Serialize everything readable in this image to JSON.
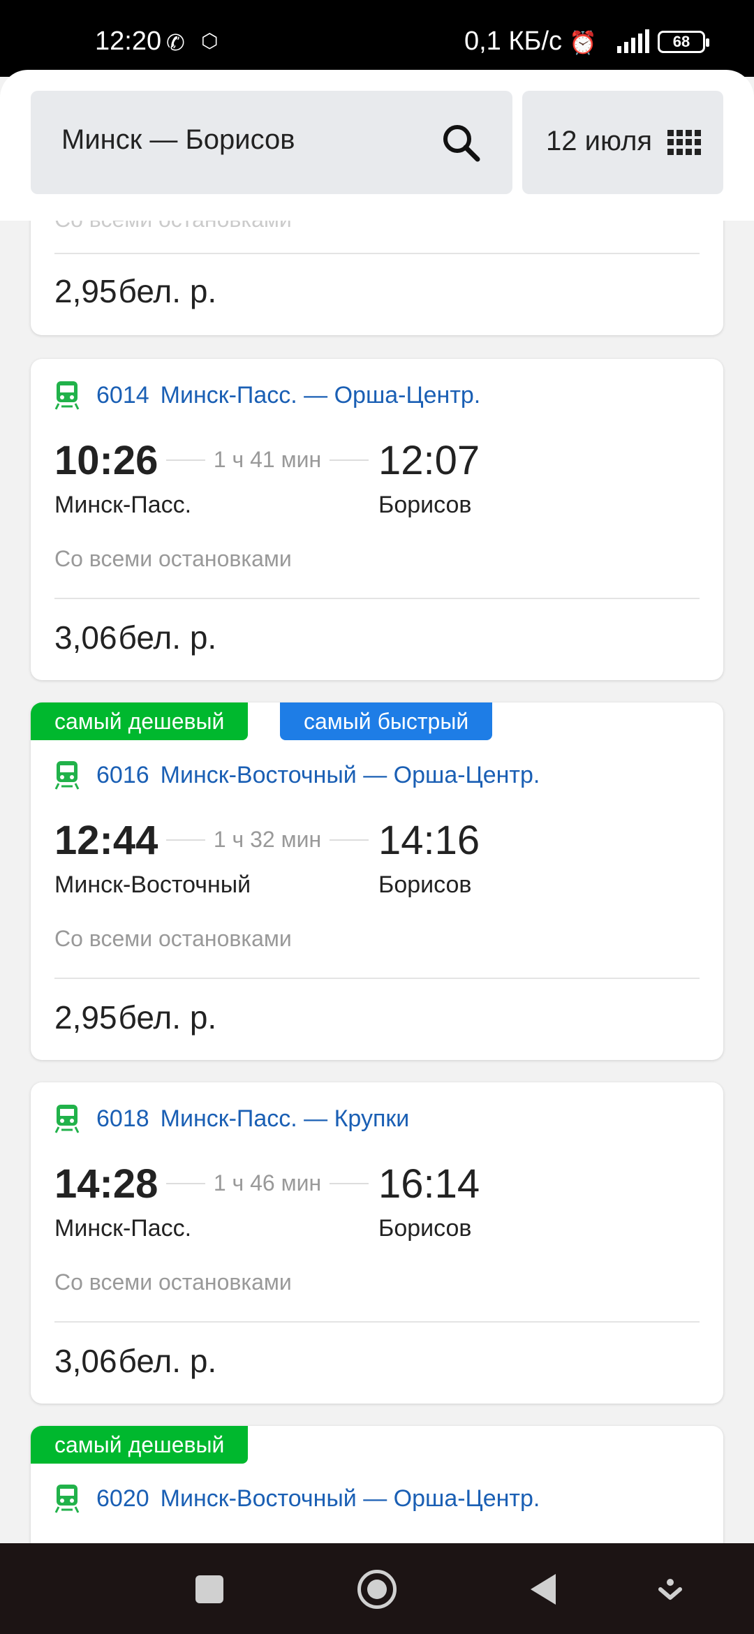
{
  "status_bar": {
    "time": "12:20",
    "network_speed": "0,1 КБ/с",
    "battery": "68"
  },
  "header": {
    "route": "Минск — Борисов",
    "date": "12 июля"
  },
  "partial_card": {
    "stops": "Со всеми остановками",
    "price": "2,95",
    "currency": "бел. р."
  },
  "trips": [
    {
      "badges": [],
      "train_number": "6014",
      "train_route": "Минск-Пасс. — Орша-Центр.",
      "departure_time": "10:26",
      "duration": "1 ч 41 мин",
      "arrival_time": "12:07",
      "departure_station": "Минск-Пасс.",
      "arrival_station": "Борисов",
      "stops": "Со всеми остановками",
      "price": "3,06",
      "currency": "бел. р."
    },
    {
      "badges": [
        "самый дешевый",
        "самый быстрый"
      ],
      "train_number": "6016",
      "train_route": "Минск-Восточный — Орша-Центр.",
      "departure_time": "12:44",
      "duration": "1 ч 32 мин",
      "arrival_time": "14:16",
      "departure_station": "Минск-Восточный",
      "arrival_station": "Борисов",
      "stops": "Со всеми остановками",
      "price": "2,95",
      "currency": "бел. р."
    },
    {
      "badges": [],
      "train_number": "6018",
      "train_route": "Минск-Пасс. — Крупки",
      "departure_time": "14:28",
      "duration": "1 ч 46 мин",
      "arrival_time": "16:14",
      "departure_station": "Минск-Пасс.",
      "arrival_station": "Борисов",
      "stops": "Со всеми остановками",
      "price": "3,06",
      "currency": "бел. р."
    },
    {
      "badges": [
        "самый дешевый"
      ],
      "train_number": "6020",
      "train_route": "Минск-Восточный — Орша-Центр."
    }
  ],
  "colors": {
    "badge_cheapest": "#00b82e",
    "badge_fastest": "#1e7de6",
    "link": "#1a5fb4",
    "train_icon": "#21b24a"
  }
}
